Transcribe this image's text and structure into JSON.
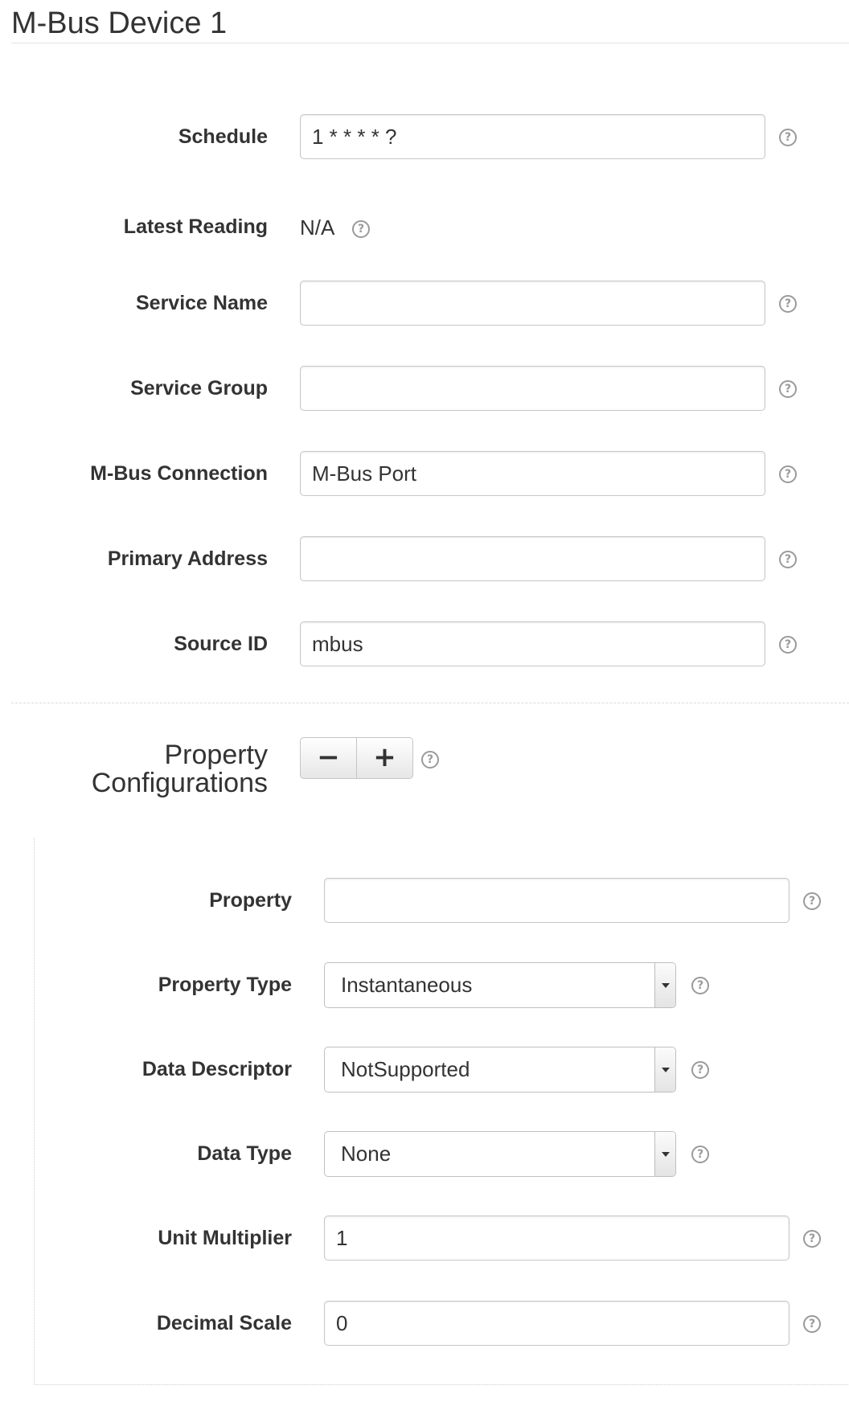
{
  "page": {
    "title": "M-Bus Device 1"
  },
  "help_glyph": "?",
  "fields": {
    "schedule": {
      "label": "Schedule",
      "value": "1 * * * * ?"
    },
    "latest_reading": {
      "label": "Latest Reading",
      "value": "N/A"
    },
    "service_name": {
      "label": "Service Name",
      "value": ""
    },
    "service_group": {
      "label": "Service Group",
      "value": ""
    },
    "mbus_connection": {
      "label": "M-Bus Connection",
      "value": "M-Bus Port"
    },
    "primary_address": {
      "label": "Primary Address",
      "value": ""
    },
    "source_id": {
      "label": "Source ID",
      "value": "mbus"
    }
  },
  "property_configurations": {
    "label_line1": "Property",
    "label_line2": "Configurations",
    "remove_label": "−",
    "add_label": "+",
    "items": [
      {
        "property": {
          "label": "Property",
          "value": ""
        },
        "property_type": {
          "label": "Property Type",
          "selected": "Instantaneous"
        },
        "data_descriptor": {
          "label": "Data Descriptor",
          "selected": "NotSupported"
        },
        "data_type": {
          "label": "Data Type",
          "selected": "None"
        },
        "unit_multiplier": {
          "label": "Unit Multiplier",
          "value": "1"
        },
        "decimal_scale": {
          "label": "Decimal Scale",
          "value": "0"
        }
      }
    ]
  }
}
